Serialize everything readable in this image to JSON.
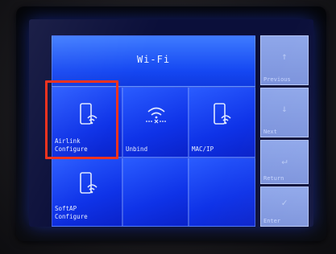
{
  "screen": {
    "title": "Wi-Fi",
    "tiles": [
      {
        "label_line1": "Airlink",
        "label_line2": "Configure",
        "icon": "phone-wifi-icon"
      },
      {
        "label_line1": "Unbind",
        "label_line2": "",
        "icon": "wifi-unbind-icon"
      },
      {
        "label_line1": "MAC/IP",
        "label_line2": "",
        "icon": "phone-wifi-icon"
      },
      {
        "label_line1": "SoftAP",
        "label_line2": "Configure",
        "icon": "phone-wifi-icon"
      }
    ],
    "side_buttons": [
      {
        "label": "Previous",
        "icon": "arrow-up-icon"
      },
      {
        "label": "Next",
        "icon": "arrow-down-icon"
      },
      {
        "label": "Return",
        "icon": "return-icon"
      },
      {
        "label": "Enter",
        "icon": "check-icon"
      }
    ]
  },
  "colors": {
    "tile_blue": "#1f4cf5",
    "side_button": "#8ea4e8",
    "highlight": "#f2331f"
  }
}
